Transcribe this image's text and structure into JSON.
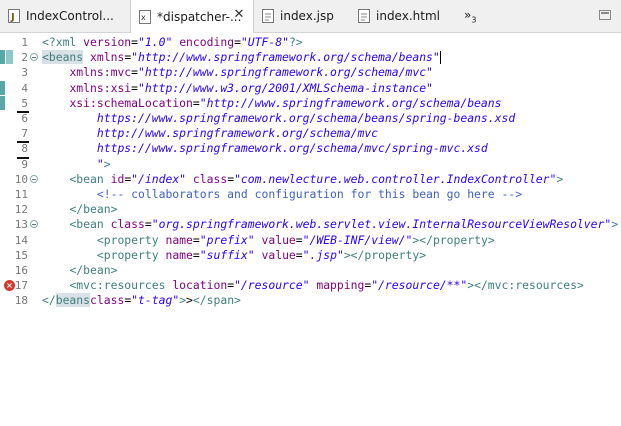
{
  "tabs": [
    {
      "label": "IndexControl...",
      "icon": "java-file-icon",
      "active": false
    },
    {
      "label": "*dispatcher-...",
      "icon": "xml-file-icon",
      "active": true
    },
    {
      "label": "index.jsp",
      "icon": "jsp-file-icon",
      "active": false
    },
    {
      "label": "index.html",
      "icon": "html-file-icon",
      "active": false
    }
  ],
  "overflow": {
    "glyph": "»",
    "count": "3"
  },
  "editor": {
    "lines": [
      {
        "num": "1",
        "code": "<?xml version=\"1.0\" encoding=\"UTF-8\"?>"
      },
      {
        "num": "2",
        "code": "<beans xmlns=\"http://www.springframework.org/schema/beans\""
      },
      {
        "num": "3",
        "code": "    xmlns:mvc=\"http://www.springframework.org/schema/mvc\""
      },
      {
        "num": "4",
        "code": "    xmlns:xsi=\"http://www.w3.org/2001/XMLSchema-instance\""
      },
      {
        "num": "5",
        "code": "    xsi:schemaLocation=\"http://www.springframework.org/schema/beans"
      },
      {
        "num": "6",
        "code": "        https://www.springframework.org/schema/beans/spring-beans.xsd"
      },
      {
        "num": "7",
        "code": "        http://www.springframework.org/schema/mvc"
      },
      {
        "num": "8",
        "code": "        https://www.springframework.org/schema/mvc/spring-mvc.xsd"
      },
      {
        "num": "9",
        "code": "        \">"
      },
      {
        "num": "10",
        "code": "    <bean id=\"/index\" class=\"com.newlecture.web.controller.IndexController\">"
      },
      {
        "num": "11",
        "code": "        <!-- collaborators and configuration for this bean go here -->"
      },
      {
        "num": "12",
        "code": "    </bean>"
      },
      {
        "num": "13",
        "code": "    <bean class=\"org.springframework.web.servlet.view.InternalResourceViewResolver\">"
      },
      {
        "num": "14",
        "code": "        <property name=\"prefix\" value=\"/WEB-INF/view/\"></property>"
      },
      {
        "num": "15",
        "code": "        <property name=\"suffix\" value=\".jsp\"></property>"
      },
      {
        "num": "16",
        "code": "    </bean>"
      },
      {
        "num": "17",
        "code": "    <mvc:resources location=\"/resource\" mapping=\"/resource/**\"></mvc:resources>"
      },
      {
        "num": "18",
        "code": "</beans>"
      }
    ]
  },
  "colors": {
    "tag": "#3f7f7f",
    "attribute": "#7f007f",
    "value": "#2a00ff",
    "comment": "#3f5fbf",
    "error": "#d23a2f"
  }
}
